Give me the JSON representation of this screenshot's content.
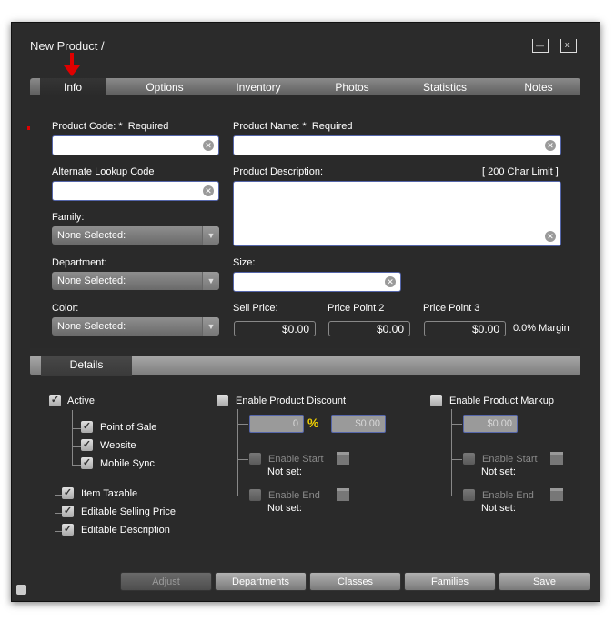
{
  "window": {
    "title": "New Product /"
  },
  "tabs": [
    "Info",
    "Options",
    "Inventory",
    "Photos",
    "Statistics",
    "Notes"
  ],
  "form": {
    "product_code_label": "Product Code: *",
    "product_code_required": "Required",
    "product_name_label": "Product Name: *",
    "product_name_required": "Required",
    "alt_lookup_label": "Alternate Lookup Code",
    "description_label": "Product Description:",
    "description_limit": "[ 200 Char Limit ]",
    "family_label": "Family:",
    "family_value": "None Selected:",
    "department_label": "Department:",
    "department_value": "None Selected:",
    "size_label": "Size:",
    "color_label": "Color:",
    "color_value": "None Selected:",
    "sell_price_label": "Sell Price:",
    "sell_price_value": "$0.00",
    "price_point2_label": "Price Point 2",
    "price_point2_value": "$0.00",
    "price_point3_label": "Price Point 3",
    "price_point3_value": "$0.00",
    "margin": "0.0% Margin"
  },
  "details": {
    "tab_label": "Details",
    "active": "Active",
    "point_of_sale": "Point of Sale",
    "website": "Website",
    "mobile_sync": "Mobile Sync",
    "item_taxable": "Item Taxable",
    "editable_price": "Editable Selling Price",
    "editable_desc": "Editable Description",
    "discount_label": "Enable Product Discount",
    "discount_percent": "0",
    "percent_sign": "%",
    "discount_amount": "$0.00",
    "discount_start": "Enable Start",
    "discount_start_value": "Not set:",
    "discount_end": "Enable End",
    "discount_end_value": "Not set:",
    "markup_label": "Enable Product Markup",
    "markup_amount": "$0.00",
    "markup_start": "Enable Start",
    "markup_start_value": "Not set:",
    "markup_end": "Enable End",
    "markup_end_value": "Not set:"
  },
  "buttons": {
    "adjust": "Adjust",
    "departments": "Departments",
    "classes": "Classes",
    "families": "Families",
    "save": "Save"
  },
  "colors": {
    "arrow": "#e00000",
    "accent_percent": "#f0d000"
  }
}
